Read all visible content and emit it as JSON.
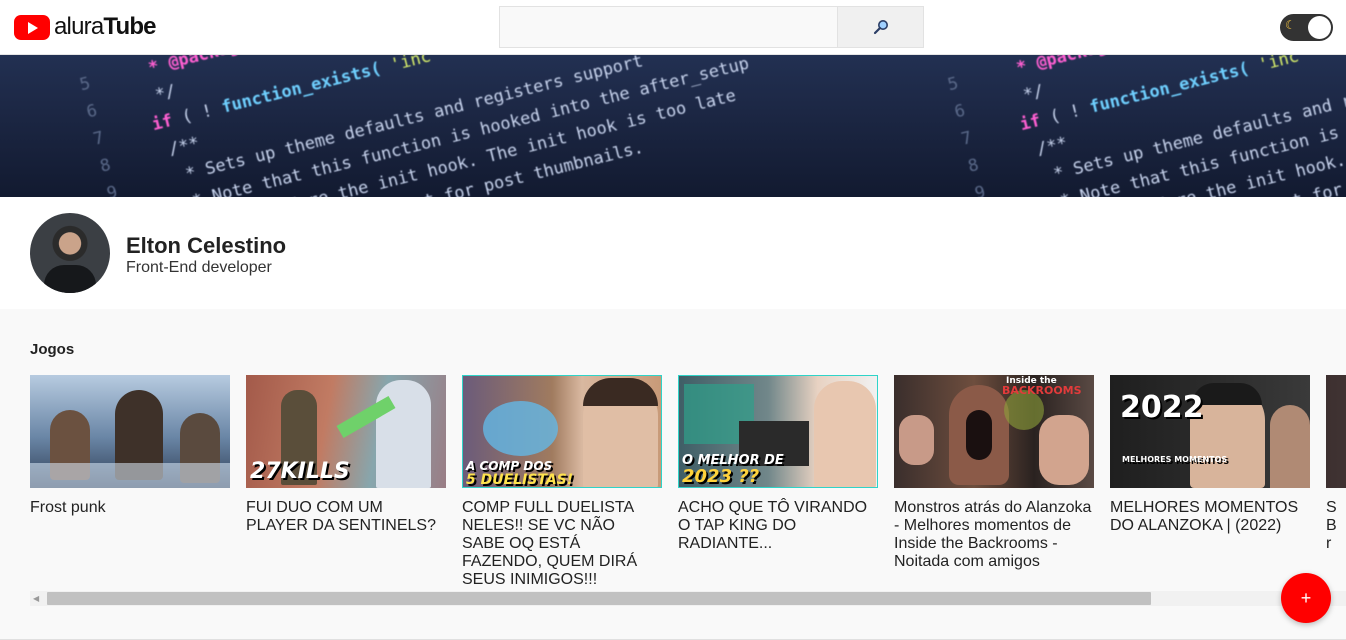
{
  "app": {
    "logo_prefix": "alura",
    "logo_suffix": "Tube"
  },
  "search": {
    "placeholder": "",
    "value": "",
    "icon": "magnifier-icon"
  },
  "theme_toggle": {
    "icon": "moon-icon",
    "state": "dark"
  },
  "profile": {
    "name": "Elton Celestino",
    "role": "Front-End developer"
  },
  "section": {
    "title": "Jogos"
  },
  "videos": [
    {
      "title": "Frost punk"
    },
    {
      "title": "FUI DUO COM UM PLAYER DA SENTINELS?",
      "thumb_text": "27KILLS"
    },
    {
      "title": "COMP FULL DUELISTA NELES!! SE VC NÃO SABE OQ ESTÁ FAZENDO, QUEM DIRÁ SEUS INIMIGOS!!!",
      "thumb_text_1": "A COMP DOS",
      "thumb_text_2": "5 DUELISTAS!"
    },
    {
      "title": "ACHO QUE TÔ VIRANDO O TAP KING DO RADIANTE...",
      "thumb_text_1": "O MELHOR DE",
      "thumb_text_2": "2023 ??"
    },
    {
      "title": "Monstros atrás do Alanzoka - Melhores momentos de Inside the Backrooms - Noitada com amigos",
      "thumb_text_1": "Inside the",
      "thumb_text_2": "BACKROOMS"
    },
    {
      "title": "MELHORES MOMENTOS DO ALANZOKA | (2022)",
      "thumb_text_1": "2022",
      "thumb_text_2": "MELHORES MOMENTOS"
    },
    {
      "title": "S B r"
    }
  ],
  "fab": {
    "label": "+"
  },
  "colors": {
    "brand": "#ff0000",
    "toggle_bg": "#333333"
  }
}
